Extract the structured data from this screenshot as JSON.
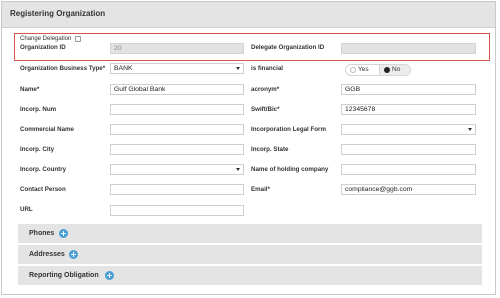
{
  "header": {
    "title": "Registering Organization"
  },
  "delegation": {
    "change_label": "Change Delegation",
    "org_id_label": "Organization ID",
    "org_id_value": "20",
    "delegate_label": "Delegate Organization ID",
    "delegate_value": ""
  },
  "form": {
    "business_type": {
      "label": "Organization Business Type*",
      "value": "BANK"
    },
    "is_financial": {
      "label": "is financial",
      "yes": "Yes",
      "no": "No",
      "selected": "No"
    },
    "name": {
      "label": "Name*",
      "value": "Gulf Global Bank"
    },
    "acronym": {
      "label": "acronym*",
      "value": "GGB"
    },
    "incorp_num": {
      "label": "Incorp. Num",
      "value": ""
    },
    "swift": {
      "label": "Swift/Bic*",
      "value": "12345678"
    },
    "commercial_name": {
      "label": "Commercial Name",
      "value": ""
    },
    "legal_form": {
      "label": "Incorporation Legal Form",
      "value": ""
    },
    "incorp_city": {
      "label": "Incorp. City",
      "value": ""
    },
    "incorp_state": {
      "label": "Incorp. State",
      "value": ""
    },
    "incorp_country": {
      "label": "Incorp. Country",
      "value": ""
    },
    "holding_company": {
      "label": "Name of holding company",
      "value": ""
    },
    "contact_person": {
      "label": "Contact Person",
      "value": ""
    },
    "email": {
      "label": "Email*",
      "value": "compliance@ggb.com"
    },
    "url": {
      "label": "URL",
      "value": ""
    }
  },
  "sections": [
    {
      "title": "Phones",
      "icon": "plus-circle-icon"
    },
    {
      "title": "Addresses",
      "icon": "plus-circle-icon"
    },
    {
      "title": "Reporting Obligation",
      "icon": "plus-circle-icon"
    }
  ],
  "colors": {
    "accent_blue": "#4a9ed6",
    "highlight_red": "#d9534f",
    "header_gray": "#e4e4e4"
  }
}
